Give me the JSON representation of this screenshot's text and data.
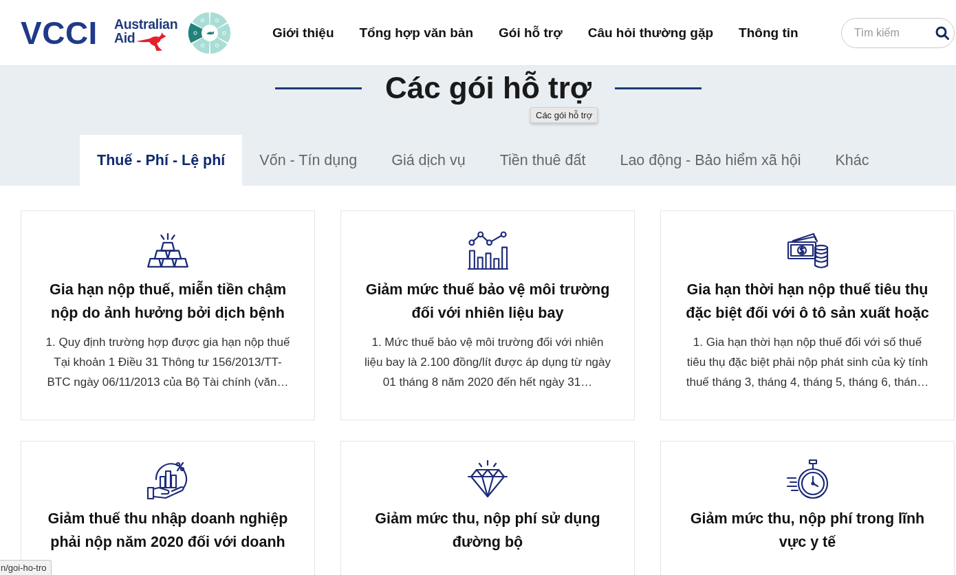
{
  "header": {
    "logos": [
      {
        "kind": "wordmark",
        "text": "VCCI"
      },
      {
        "kind": "aid",
        "line_1": "Australian",
        "line_2": "Aid"
      },
      {
        "kind": "wheel"
      }
    ],
    "nav": [
      "Giới thiệu",
      "Tổng hợp văn bản",
      "Gói hỗ trợ",
      "Câu hỏi thường gặp",
      "Thông tin"
    ],
    "search": {
      "placeholder": "Tìm kiếm"
    }
  },
  "hero": {
    "title": "Các gói hỗ trợ",
    "tooltip": "Các gói hỗ trợ"
  },
  "tabs": [
    {
      "label": "Thuế - Phí - Lệ phí",
      "selected": true
    },
    {
      "label": "Vốn - Tín dụng",
      "selected": false
    },
    {
      "label": "Giá dịch vụ",
      "selected": false
    },
    {
      "label": "Tiền thuê đất",
      "selected": false
    },
    {
      "label": "Lao động - Bảo hiểm xã hội",
      "selected": false
    },
    {
      "label": "Khác",
      "selected": false
    }
  ],
  "cards": [
    {
      "title": "Gia hạn nộp thuế, miễn tiền chậm nộp do ảnh hưởng bởi dịch bệnh",
      "description": "1. Quy định trường hợp được gia hạn nộp thuế Tại khoản 1 Điều 31 Thông tư 156/2013/TT-BTC ngày 06/11/2013 của Bộ Tài chính (văn…"
    },
    {
      "title": "Giảm mức thuế bảo vệ môi trường đối với nhiên liệu bay",
      "description": "1. Mức thuế bảo vệ môi trường đối với nhiên liệu bay là 2.100 đồng/lít được áp dụng từ ngày 01 tháng 8 năm 2020 đến hết ngày 31…"
    },
    {
      "title": "Gia hạn thời hạn nộp thuế tiêu thụ đặc biệt đối với ô tô sản xuất hoặc",
      "description": "1. Gia hạn thời hạn nộp thuế đối với số thuế tiêu thụ đặc biệt phải nộp phát sinh của kỳ tính thuế tháng 3, tháng 4, tháng 5, tháng 6, thán…"
    },
    {
      "title": "Giảm thuế thu nhập doanh nghiệp phải nộp năm 2020 đối với doanh"
    },
    {
      "title": "Giảm mức thu, nộp phí sử dụng đường bộ"
    },
    {
      "title": "Giảm mức thu, nộp phí trong lĩnh vực y tế"
    }
  ],
  "status_bar": {
    "url": "n/goi-ho-tro"
  }
}
